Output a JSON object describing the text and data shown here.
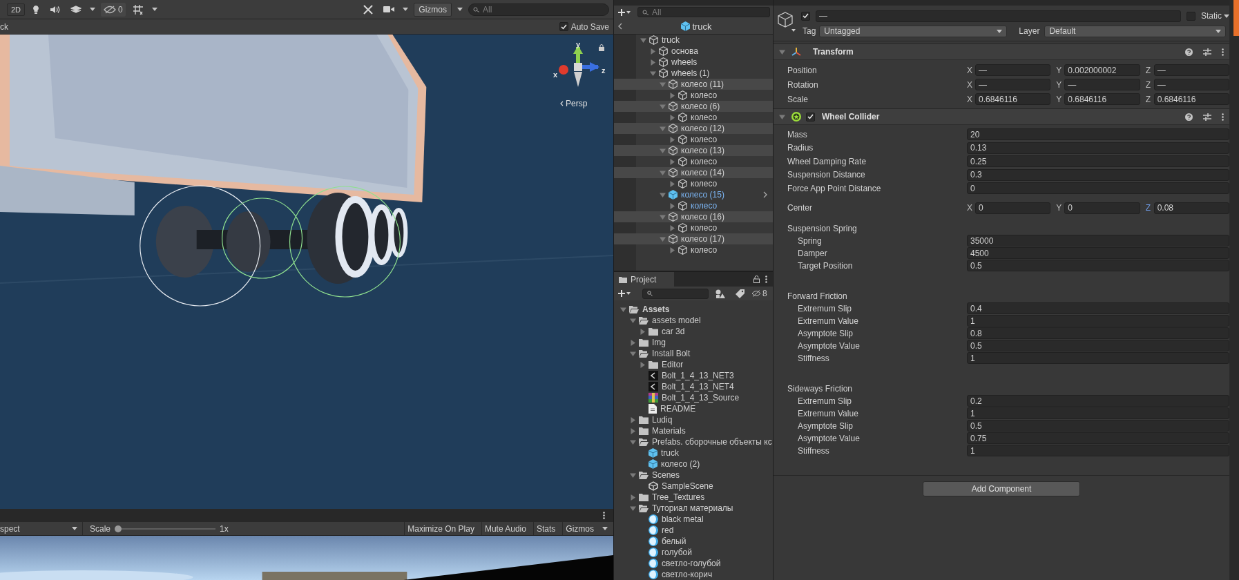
{
  "scene_toolbar": {
    "view_2d": {
      "label": "2D",
      "selected": false
    },
    "hidden_count": "0",
    "gizmos_label": "Gizmos",
    "search": {
      "placeholder": "All"
    }
  },
  "scene_bar": {
    "tab_label": "ck",
    "auto_save": {
      "label": "Auto Save",
      "checked": true
    }
  },
  "scene_view": {
    "kind": "picture",
    "gizmo": {
      "x_label": "x",
      "y_label": "y",
      "z_label": "z",
      "projection": "Persp"
    }
  },
  "game_toolbar": {
    "aspect": "spect",
    "scale_label": "Scale",
    "scale": {
      "level": 0
    },
    "scale_reading": "1x",
    "buttons": [
      "Maximize On Play",
      "Mute Audio",
      "Stats",
      "Gizmos"
    ]
  },
  "hierarchy": {
    "search": {
      "placeholder": "All"
    },
    "prefab_header": "truck",
    "items": [
      {
        "label": "truck",
        "kind": "object",
        "selected": false,
        "expanded": true,
        "children": [
          {
            "label": "основа",
            "kind": "object",
            "selected": false,
            "expanded": false
          },
          {
            "label": "wheels",
            "kind": "object",
            "selected": false,
            "expanded": false
          },
          {
            "label": "wheels (1)",
            "kind": "object",
            "selected": false,
            "expanded": true,
            "children": [
              {
                "label": "колесо (11)",
                "kind": "object",
                "selected": true,
                "expanded": true,
                "children": [
                  {
                    "label": "колесо",
                    "kind": "object",
                    "selected": false,
                    "expanded": false
                  }
                ]
              },
              {
                "label": "колесо (6)",
                "kind": "object",
                "selected": true,
                "expanded": true,
                "children": [
                  {
                    "label": "колесо",
                    "kind": "object",
                    "selected": false,
                    "expanded": false
                  }
                ]
              },
              {
                "label": "колесо (12)",
                "kind": "object",
                "selected": true,
                "expanded": true,
                "children": [
                  {
                    "label": "колесо",
                    "kind": "object",
                    "selected": false,
                    "expanded": false
                  }
                ]
              },
              {
                "label": "колесо (13)",
                "kind": "object",
                "selected": true,
                "expanded": true,
                "children": [
                  {
                    "label": "колесо",
                    "kind": "object",
                    "selected": false,
                    "expanded": false
                  }
                ]
              },
              {
                "label": "колесо (14)",
                "kind": "object",
                "selected": true,
                "expanded": true,
                "children": [
                  {
                    "label": "колесо",
                    "kind": "object",
                    "selected": false,
                    "expanded": false
                  }
                ]
              },
              {
                "label": "колесо (15)",
                "kind": "prefab_root",
                "selected": false,
                "expanded": true,
                "children": [
                  {
                    "label": "колесо",
                    "kind": "prefab_part",
                    "selected": false,
                    "expanded": false
                  }
                ]
              },
              {
                "label": "колесо (16)",
                "kind": "object",
                "selected": true,
                "expanded": true,
                "children": [
                  {
                    "label": "колесо",
                    "kind": "object",
                    "selected": false,
                    "expanded": false
                  }
                ]
              },
              {
                "label": "колесо (17)",
                "kind": "object",
                "selected": true,
                "expanded": true,
                "children": [
                  {
                    "label": "колесо",
                    "kind": "object",
                    "selected": false,
                    "expanded": false
                  }
                ]
              }
            ]
          }
        ]
      }
    ]
  },
  "project": {
    "tab": "Project",
    "hidden_count": "8",
    "items": [
      {
        "label": "Assets",
        "kind": "folder",
        "expanded": true,
        "children": [
          {
            "label": "assets model",
            "kind": "folder",
            "expanded": true,
            "children": [
              {
                "label": "car 3d",
                "kind": "folder",
                "expanded": false
              }
            ]
          },
          {
            "label": "Img",
            "kind": "folder",
            "expanded": false
          },
          {
            "label": "Install Bolt",
            "kind": "folder",
            "expanded": true,
            "children": [
              {
                "label": "Editor",
                "kind": "folder",
                "expanded": false
              },
              {
                "label": "Bolt_1_4_13_NET3",
                "kind": "assembly"
              },
              {
                "label": "Bolt_1_4_13_NET4",
                "kind": "assembly"
              },
              {
                "label": "Bolt_1_4_13_Source",
                "kind": "archive"
              },
              {
                "label": "README",
                "kind": "text"
              }
            ]
          },
          {
            "label": "Ludiq",
            "kind": "folder",
            "expanded": false
          },
          {
            "label": "Materials",
            "kind": "folder",
            "expanded": false
          },
          {
            "label": "Prefabs. сборочные объекты кс",
            "kind": "folder",
            "expanded": true,
            "children": [
              {
                "label": "truck",
                "kind": "prefab"
              },
              {
                "label": "колесо (2)",
                "kind": "prefab"
              }
            ]
          },
          {
            "label": "Scenes",
            "kind": "folder",
            "expanded": true,
            "children": [
              {
                "label": "SampleScene",
                "kind": "scene"
              }
            ]
          },
          {
            "label": "Tree_Textures",
            "kind": "folder",
            "expanded": false
          },
          {
            "label": "Туториал материалы",
            "kind": "folder",
            "expanded": true,
            "children": [
              {
                "label": "black metal",
                "kind": "material"
              },
              {
                "label": "red",
                "kind": "material"
              },
              {
                "label": "белый",
                "kind": "material"
              },
              {
                "label": "голубой",
                "kind": "material"
              },
              {
                "label": "светло-голубой",
                "kind": "material"
              },
              {
                "label": "светло-корич",
                "kind": "material"
              }
            ]
          }
        ]
      }
    ]
  },
  "inspector": {
    "object": {
      "active": true,
      "name": "—",
      "static": false,
      "static_label": "Static",
      "tag_label": "Tag",
      "tag": "Untagged",
      "layer_label": "Layer",
      "layer": "Default"
    },
    "components": [
      {
        "kind": "transform",
        "title": "Transform",
        "rows": [
          {
            "label": "Position",
            "axes": [
              {
                "axis": "X",
                "value": "—"
              },
              {
                "axis": "Y",
                "value": "0.002000002"
              },
              {
                "axis": "Z",
                "value": "—"
              }
            ]
          },
          {
            "label": "Rotation",
            "axes": [
              {
                "axis": "X",
                "value": "—"
              },
              {
                "axis": "Y",
                "value": "—"
              },
              {
                "axis": "Z",
                "value": "—"
              }
            ]
          },
          {
            "label": "Scale",
            "axes": [
              {
                "axis": "X",
                "value": "0.6846116"
              },
              {
                "axis": "Y",
                "value": "0.6846116"
              },
              {
                "axis": "Z",
                "value": "0.6846116"
              }
            ]
          }
        ]
      },
      {
        "kind": "wheel_collider",
        "title": "Wheel Collider",
        "enabled": true,
        "fields": [
          {
            "label": "Mass",
            "value": "20"
          },
          {
            "label": "Radius",
            "value": "0.13"
          },
          {
            "label": "Wheel Damping Rate",
            "value": "0.25"
          },
          {
            "label": "Suspension Distance",
            "value": "0.3"
          },
          {
            "label": "Force App Point Distance",
            "value": "0"
          }
        ],
        "center": {
          "label": "Center",
          "axes": [
            {
              "axis": "X",
              "value": "0",
              "overridden": false
            },
            {
              "axis": "Y",
              "value": "0",
              "overridden": false
            },
            {
              "axis": "Z",
              "value": "0.08",
              "overridden": true
            }
          ]
        },
        "groups": [
          {
            "title": "Suspension Spring",
            "fields": [
              {
                "label": "Spring",
                "value": "35000"
              },
              {
                "label": "Damper",
                "value": "4500"
              },
              {
                "label": "Target Position",
                "value": "0.5"
              }
            ]
          },
          {
            "title": "Forward Friction",
            "fields": [
              {
                "label": "Extremum Slip",
                "value": "0.4"
              },
              {
                "label": "Extremum Value",
                "value": "1"
              },
              {
                "label": "Asymptote Slip",
                "value": "0.8"
              },
              {
                "label": "Asymptote Value",
                "value": "0.5"
              },
              {
                "label": "Stiffness",
                "value": "1"
              }
            ]
          },
          {
            "title": "Sideways Friction",
            "fields": [
              {
                "label": "Extremum Slip",
                "value": "0.2"
              },
              {
                "label": "Extremum Value",
                "value": "1"
              },
              {
                "label": "Asymptote Slip",
                "value": "0.5"
              },
              {
                "label": "Asymptote Value",
                "value": "0.75"
              },
              {
                "label": "Stiffness",
                "value": "1"
              }
            ]
          }
        ]
      }
    ],
    "add_component": "Add Component"
  }
}
